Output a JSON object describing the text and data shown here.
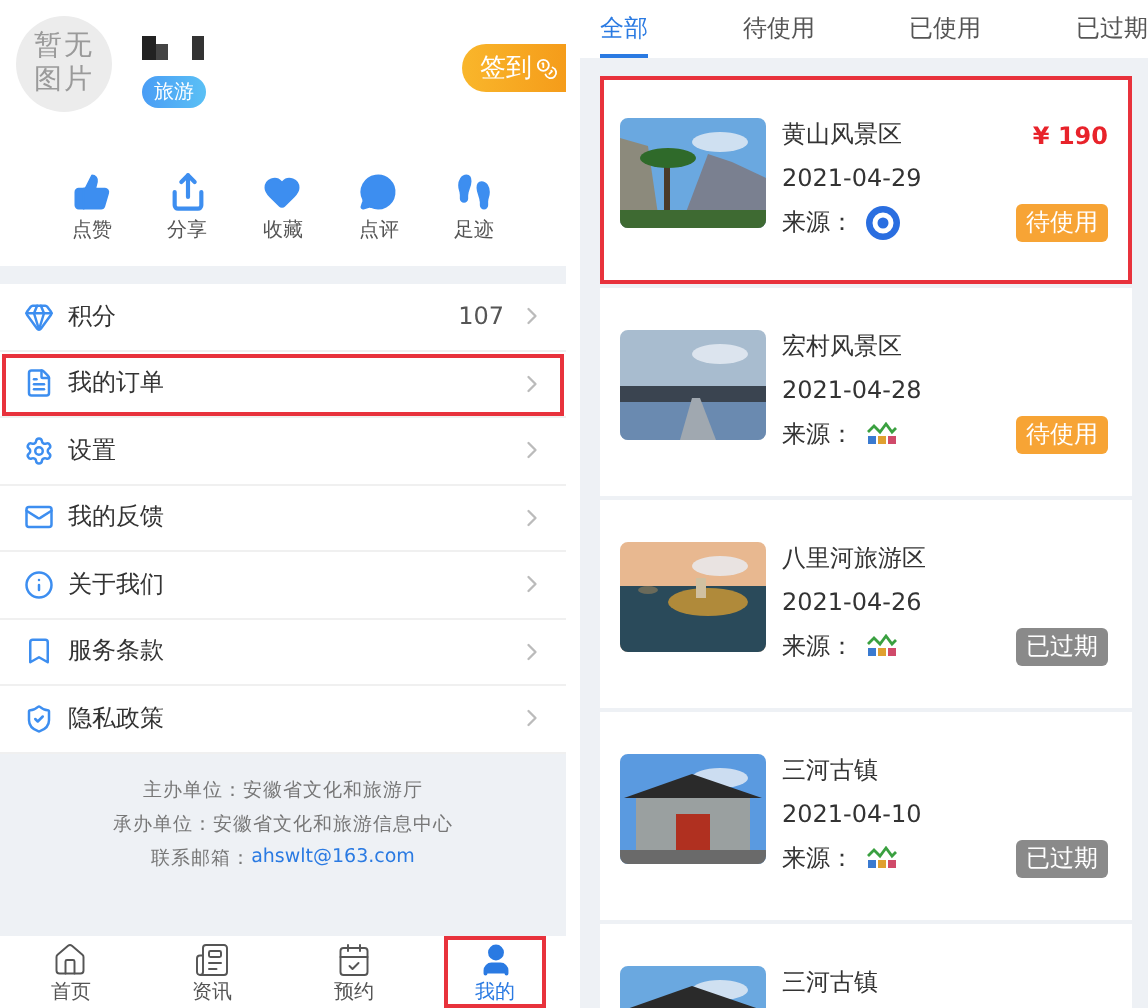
{
  "profile": {
    "avatar_text": "暂无图片",
    "tag": "旅游",
    "checkin_button": "签到"
  },
  "actions": [
    {
      "label": "点赞"
    },
    {
      "label": "分享"
    },
    {
      "label": "收藏"
    },
    {
      "label": "点评"
    },
    {
      "label": "足迹"
    }
  ],
  "menu": [
    {
      "label": "积分",
      "value": "107",
      "highlighted": false
    },
    {
      "label": "我的订单",
      "highlighted": true
    },
    {
      "label": "设置",
      "highlighted": false
    },
    {
      "label": "我的反馈",
      "highlighted": false
    },
    {
      "label": "关于我们",
      "highlighted": false
    },
    {
      "label": "服务条款",
      "highlighted": false
    },
    {
      "label": "隐私政策",
      "highlighted": false
    }
  ],
  "footer": {
    "lines": [
      "主办单位：安徽省文化和旅游厅",
      "承办单位：安徽省文化和旅游信息中心"
    ],
    "contact_label": "联系邮箱：",
    "contact_email": "ahswlt@163.com"
  },
  "tabbar": [
    {
      "label": "首页",
      "selected": false,
      "highlighted": false
    },
    {
      "label": "资讯",
      "selected": false,
      "highlighted": false
    },
    {
      "label": "预约",
      "selected": false,
      "highlighted": false
    },
    {
      "label": "我的",
      "selected": true,
      "highlighted": true
    }
  ],
  "order_tabs": [
    {
      "label": "全部",
      "selected": true
    },
    {
      "label": "待使用",
      "selected": false
    },
    {
      "label": "已使用",
      "selected": false
    },
    {
      "label": "已过期",
      "selected": false
    }
  ],
  "orders": [
    {
      "title": "黄山风景区",
      "date": "2021-04-29",
      "source": {
        "label": "来源：",
        "kind": "app"
      },
      "price": "¥ 190",
      "status": {
        "text": "待使用",
        "kind": "pending"
      },
      "highlighted": true
    },
    {
      "title": "宏村风景区",
      "date": "2021-04-28",
      "source": {
        "label": "来源：",
        "kind": "tour"
      },
      "status": {
        "text": "待使用",
        "kind": "pending"
      },
      "highlighted": false
    },
    {
      "title": "八里河旅游区",
      "date": "2021-04-26",
      "source": {
        "label": "来源：",
        "kind": "tour"
      },
      "status": {
        "text": "已过期",
        "kind": "expired"
      },
      "highlighted": false
    },
    {
      "title": "三河古镇",
      "date": "2021-04-10",
      "source": {
        "label": "来源：",
        "kind": "tour"
      },
      "status": {
        "text": "已过期",
        "kind": "expired"
      },
      "highlighted": false
    },
    {
      "title": "三河古镇",
      "highlighted": false
    }
  ]
}
